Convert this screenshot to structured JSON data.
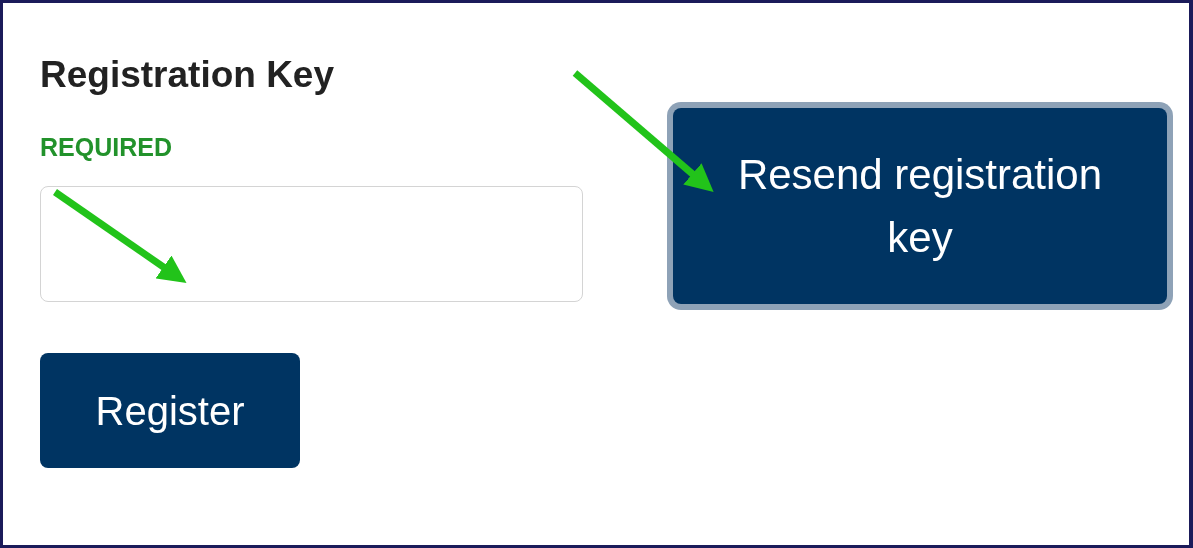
{
  "heading": "Registration Key",
  "required_label": "REQUIRED",
  "register_button": {
    "label": "Register",
    "focused": false
  },
  "resend_button": {
    "label": "Resend registration key",
    "focused": true
  }
}
